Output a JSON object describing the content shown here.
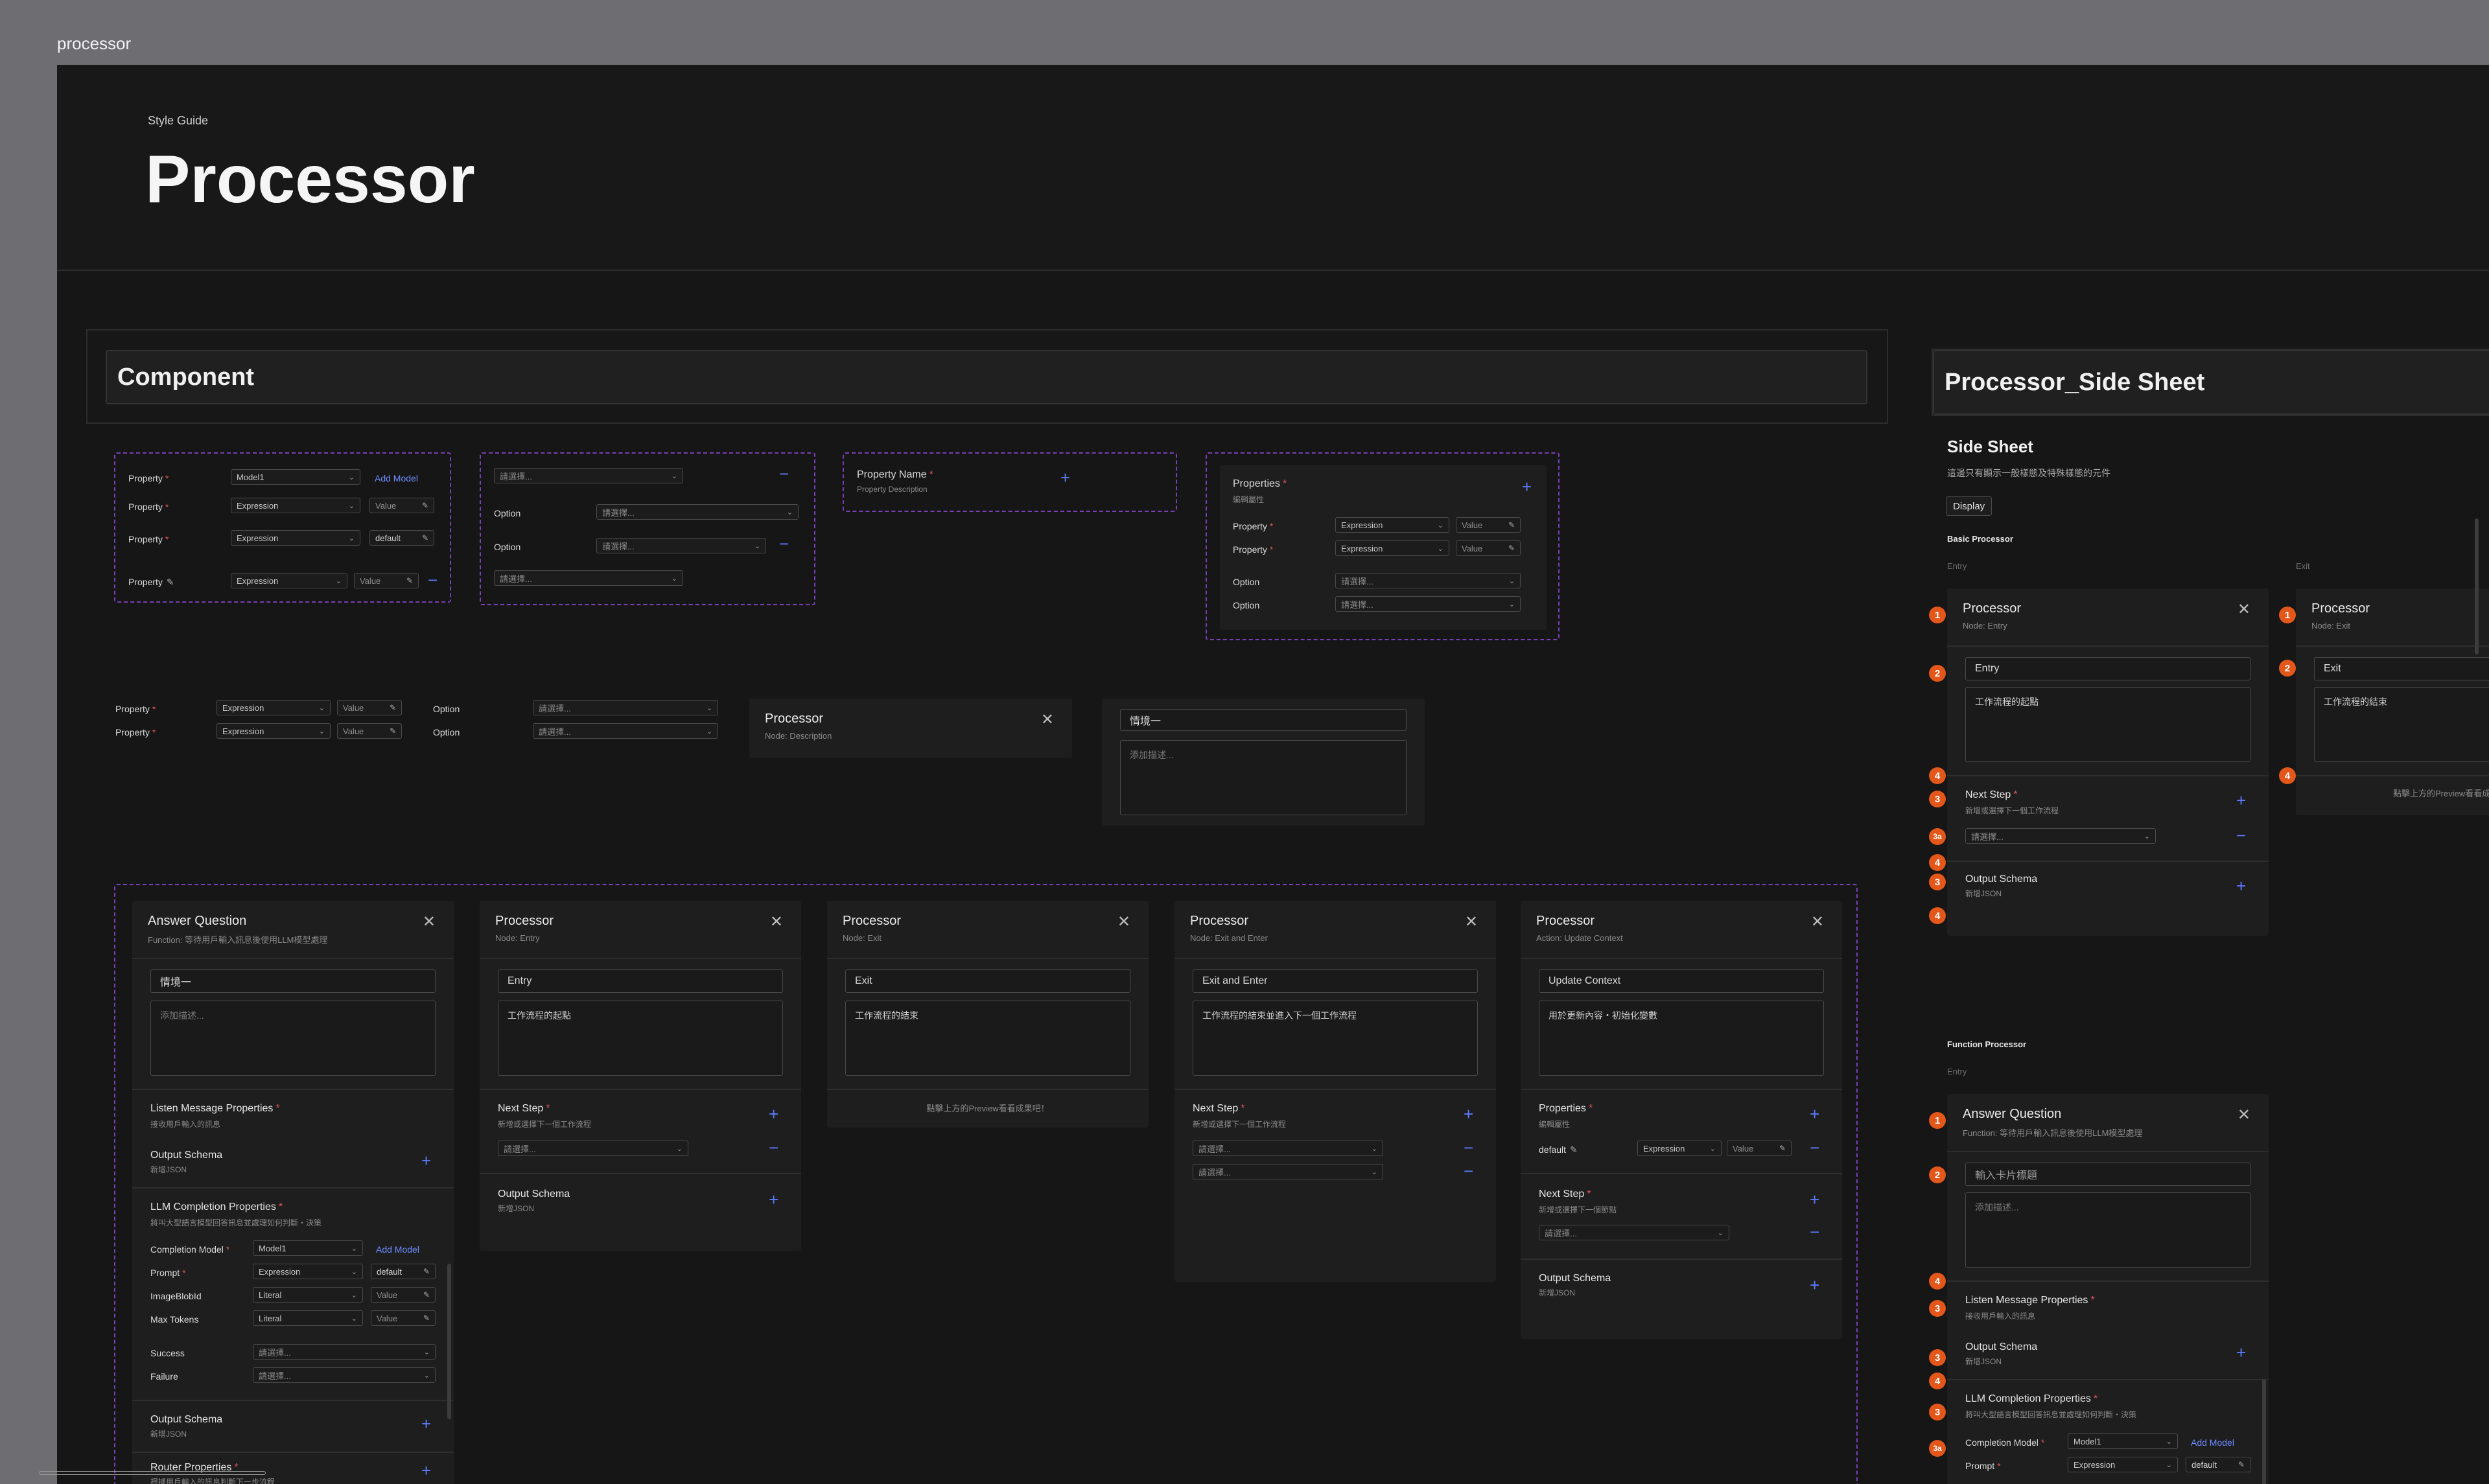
{
  "frame_label": "processor",
  "header": {
    "eyebrow": "Style Guide",
    "title": "Processor"
  },
  "component_section": {
    "title": "Component"
  },
  "side_section": {
    "title": "Processor_Side Sheet",
    "heading": "Side Sheet",
    "description": "這邊只有顯示一般樣態及特殊樣態的元件",
    "display_button": "Display",
    "basic_label": "Basic Processor",
    "entry_label": "Entry",
    "exit_label": "Exit",
    "function_label": "Function Processor",
    "function_entry_label": "Entry"
  },
  "common": {
    "property": "Property",
    "option": "Option",
    "expression": "Expression",
    "literal": "Literal",
    "value": "Value",
    "default": "default",
    "model": "Model1",
    "add_model": "Add Model",
    "select_placeholder": "請選擇...",
    "property_name": "Property Name",
    "property_desc": "Property Description",
    "properties": "Properties",
    "properties_sub": "編輯屬性",
    "processor": "Processor",
    "node_description": "Node: Description",
    "scenario": "情境一",
    "add_description": "添加描述...",
    "next_step": "Next Step",
    "next_step_sub": "新增或選擇下一個工作流程",
    "output_schema": "Output Schema",
    "output_schema_sub": "新增JSON",
    "preview_note": "點擊上方的Preview看看成果吧！",
    "preview_note_short": "點擊上方的Preview看看成"
  },
  "cards": {
    "answer": {
      "title": "Answer Question",
      "subtitle": "Function: 等待用戶輸入訊息後使用LLM模型處理",
      "listen": "Listen Message Properties",
      "listen_sub": "接收用戶輸入的訊息",
      "llm": "LLM Completion Properties",
      "llm_sub": "將叫大型語言模型回答訊息並處理如何判斷・決策",
      "completion_model": "Completion Model",
      "prompt": "Prompt",
      "image_blob": "ImageBlobId",
      "max_tokens": "Max Tokens",
      "success": "Success",
      "failure": "Failure",
      "router": "Router Properties",
      "router_sub": "根據用戶輸入的訊息判斷下一步流程",
      "card_title_placeholder": "輸入卡片標題"
    },
    "entry": {
      "subtitle": "Node: Entry",
      "name": "Entry",
      "desc": "工作流程的起點"
    },
    "exit": {
      "subtitle": "Node: Exit",
      "name": "Exit",
      "desc": "工作流程的結束"
    },
    "exit_enter": {
      "subtitle": "Node: Exit and Enter",
      "name": "Exit and Enter",
      "desc": "工作流程的結束並進入下一個工作流程"
    },
    "update": {
      "subtitle": "Action: Update Context",
      "name": "Update Context",
      "desc": "用於更新內容・初始化變數",
      "next_step_sub": "新增或選擇下一個節點"
    }
  },
  "badges": {
    "b1": "1",
    "b2": "2",
    "b3": "3",
    "b4": "4",
    "b3a": "3a"
  },
  "colors": {
    "canvas": "#161616",
    "accent_dash": "#7b3fb8",
    "link": "#6c8cff",
    "badge": "#e4571b",
    "required": "#e05555"
  }
}
